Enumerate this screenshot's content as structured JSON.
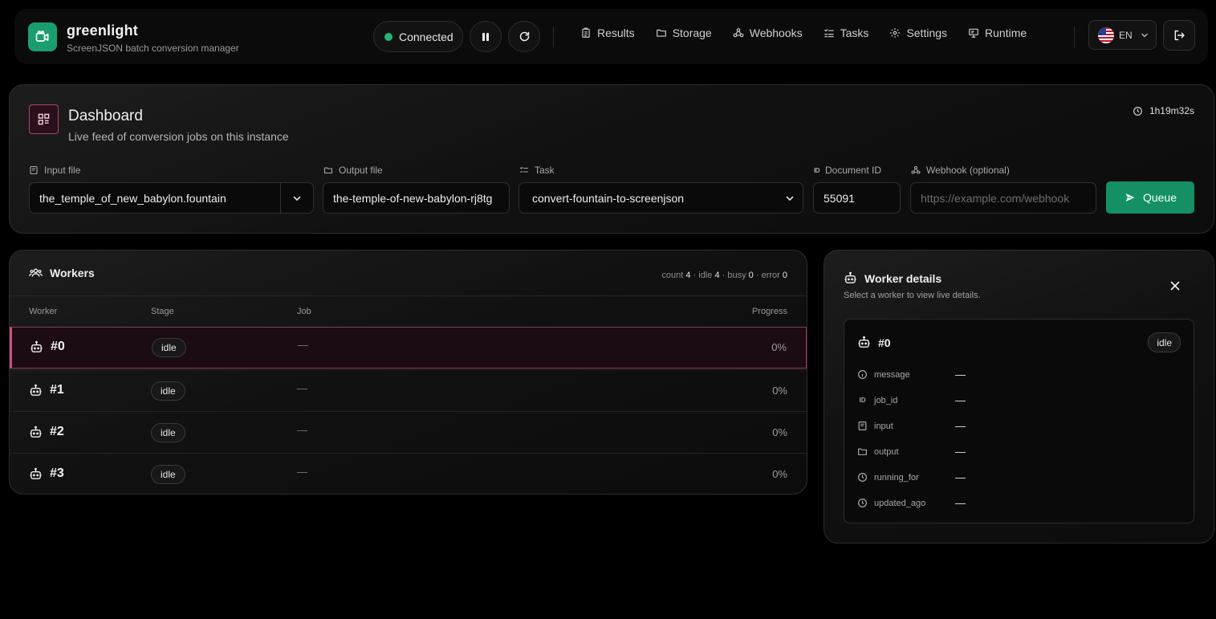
{
  "brand": {
    "name": "greenlight",
    "subtitle": "ScreenJSON batch conversion manager"
  },
  "connection": {
    "status": "Connected",
    "status_color": "#22b573"
  },
  "nav": {
    "items": [
      {
        "label": "Results",
        "icon": "clipboard-icon"
      },
      {
        "label": "Storage",
        "icon": "folder-icon"
      },
      {
        "label": "Webhooks",
        "icon": "webhook-icon"
      },
      {
        "label": "Tasks",
        "icon": "list-check-icon"
      },
      {
        "label": "Settings",
        "icon": "gear-icon"
      },
      {
        "label": "Runtime",
        "icon": "monitor-icon"
      }
    ]
  },
  "language": {
    "code": "EN",
    "icon": "us-flag-icon"
  },
  "dashboard": {
    "title": "Dashboard",
    "subtitle": "Live feed of conversion jobs on this instance",
    "uptime": "1h19m32s"
  },
  "form": {
    "input_file": {
      "label": "Input file",
      "value": "the_temple_of_new_babylon.fountain"
    },
    "output_file": {
      "label": "Output file",
      "value": "the-temple-of-new-babylon-rj8tg"
    },
    "task": {
      "label": "Task",
      "value": "convert-fountain-to-screenjson"
    },
    "document_id": {
      "label": "Document ID",
      "id_glyph": "ID",
      "value": "55091"
    },
    "webhook": {
      "label": "Webhook (optional)",
      "placeholder": "https://example.com/webhook"
    },
    "submit_label": "Queue"
  },
  "workers": {
    "title": "Workers",
    "counts": [
      {
        "label": "count",
        "value": "4"
      },
      {
        "label": "idle",
        "value": "4"
      },
      {
        "label": "busy",
        "value": "0"
      },
      {
        "label": "error",
        "value": "0"
      }
    ],
    "columns": {
      "worker": "Worker",
      "stage": "Stage",
      "job": "Job",
      "progress": "Progress"
    },
    "rows": [
      {
        "id": "#0",
        "stage": "idle",
        "job": "—",
        "progress": "0%"
      },
      {
        "id": "#1",
        "stage": "idle",
        "job": "—",
        "progress": "0%"
      },
      {
        "id": "#2",
        "stage": "idle",
        "job": "—",
        "progress": "0%"
      },
      {
        "id": "#3",
        "stage": "idle",
        "job": "—",
        "progress": "0%"
      }
    ]
  },
  "details": {
    "title": "Worker details",
    "subtitle": "Select a worker to view live details.",
    "worker_id": "#0",
    "status": "idle",
    "fields": [
      {
        "key": "message",
        "value": "—"
      },
      {
        "key": "job_id",
        "id_glyph": "ID",
        "value": "—"
      },
      {
        "key": "input",
        "value": "—"
      },
      {
        "key": "output",
        "value": "—"
      },
      {
        "key": "running_for",
        "value": "—"
      },
      {
        "key": "updated_ago",
        "value": "—"
      }
    ]
  },
  "colors": {
    "accent": "#149064",
    "selected_border": "#c0547e",
    "background": "#000000"
  }
}
